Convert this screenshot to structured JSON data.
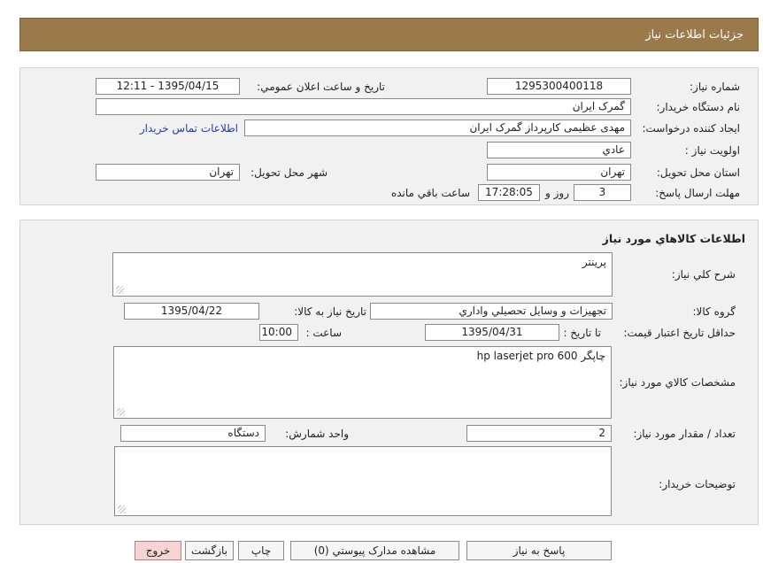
{
  "header": {
    "title": "جزئيات اطلاعات نياز"
  },
  "info": {
    "need_number_label": "شماره نياز:",
    "need_number": "1295300400118",
    "announce_label": "تاريخ و ساعت اعلان عمومي:",
    "announce_value": "1395/04/15 - 12:11",
    "buyer_org_label": "نام دستگاه خريدار:",
    "buyer_org": "گمرک ايران",
    "creator_label": "ايجاد کننده درخواست:",
    "creator": "مهدی عظیمی کارپرداز گمرک ایران",
    "contact_link": "اطلاعات تماس خريدار",
    "priority_label": "اولويت نياز :",
    "priority": "عادي",
    "province_label": "استان محل تحويل:",
    "province": "تهران",
    "city_label": "شهر محل تحويل:",
    "city": "تهران",
    "deadline_label": "مهلت ارسال پاسخ:",
    "days": "3",
    "days_suffix": "روز و",
    "time_left": "17:28:05",
    "time_suffix": "ساعت باقي مانده"
  },
  "goods": {
    "section_title": "اطلاعات کالاهاي مورد نياز",
    "summary_label": "شرح کلي نياز:",
    "summary": "پرينتر",
    "group_label": "گروه کالا:",
    "group": "تجهيزات و وسايل تحصيلي واداري",
    "need_date_label": "تاريخ نياز به کالا:",
    "need_date": "1395/04/22",
    "price_valid_label": "حداقل تاريخ اعتبار قيمت:",
    "to_date_label": "تا تاريخ :",
    "to_date": "1395/04/31",
    "time_label": "ساعت :",
    "time": "10:00",
    "specs_label": "مشخصات کالاي مورد نياز:",
    "specs": "چاپگر hp laserjet pro  600",
    "qty_label": "تعداد / مقدار مورد نياز:",
    "qty": "2",
    "unit_label": "واحد شمارش:",
    "unit": "دستگاه",
    "buyer_notes_label": "توضيحات خريدار:",
    "buyer_notes": ""
  },
  "buttons": {
    "reply": "پاسخ به نياز",
    "view_docs": "مشاهده مدارک پيوستي (0)",
    "print": "چاپ",
    "back": "بازگشت",
    "exit": "خروج"
  },
  "colors": {
    "header_bg": "#9a7a4a",
    "link": "#1f3fb0",
    "exit_bg": "#f6d4d4"
  }
}
